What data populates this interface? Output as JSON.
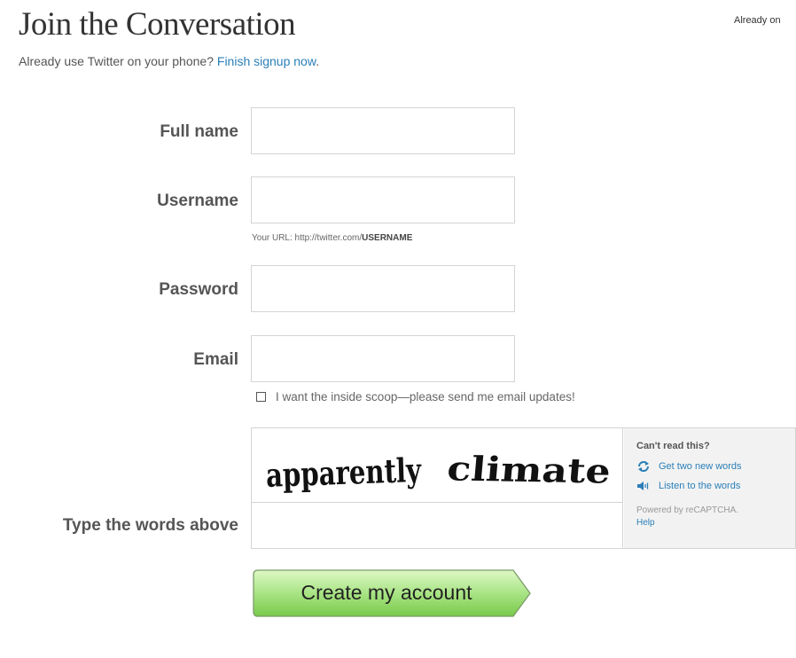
{
  "page": {
    "title": "Join the Conversation",
    "already_on": "Already on",
    "subtitle_text": "Already use Twitter on your phone?",
    "subtitle_link": "Finish signup now",
    "subtitle_end": "."
  },
  "form": {
    "full_name_label": "Full name",
    "username_label": "Username",
    "url_hint_prefix": "Your URL: http://twitter.com/",
    "url_hint_user": "USERNAME",
    "password_label": "Password",
    "email_label": "Email",
    "updates_checkbox_label": "I want the inside scoop—please send me email updates!",
    "updates_checked": false,
    "captcha_label": "Type the words above"
  },
  "captcha": {
    "words": "apparently climate",
    "help_title": "Can't read this?",
    "refresh_link": "Get two new words",
    "audio_link": "Listen to the words",
    "powered_by": "Powered by reCAPTCHA.",
    "help_link": "Help"
  },
  "submit": {
    "label": "Create my account"
  },
  "colors": {
    "link": "#2a7fb8",
    "button_green_top": "#d6f5b6",
    "button_green_bottom": "#7fce4e"
  }
}
